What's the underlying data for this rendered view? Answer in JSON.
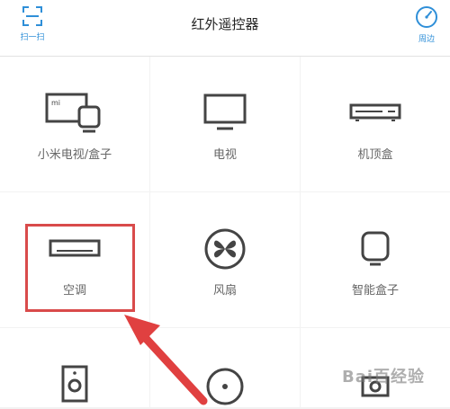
{
  "header": {
    "title": "红外遥控器",
    "scan_label": "扫一扫",
    "nearby_label": "周边"
  },
  "devices": [
    {
      "label": "小米电视/盒子",
      "icon": "mi-tv-box-icon"
    },
    {
      "label": "电视",
      "icon": "tv-icon"
    },
    {
      "label": "机顶盒",
      "icon": "set-top-box-icon"
    },
    {
      "label": "空调",
      "icon": "air-conditioner-icon",
      "highlighted": true
    },
    {
      "label": "风扇",
      "icon": "fan-icon"
    },
    {
      "label": "智能盒子",
      "icon": "smart-box-icon"
    },
    {
      "label": "",
      "icon": "speaker-icon"
    },
    {
      "label": "",
      "icon": "projector-icon"
    },
    {
      "label": "",
      "icon": "camera-icon"
    }
  ],
  "colors": {
    "accent": "#2f8fd8",
    "highlight": "#d94b4b",
    "icon": "#444444",
    "label": "#666666"
  },
  "watermark": {
    "text": "Bai百经验"
  }
}
